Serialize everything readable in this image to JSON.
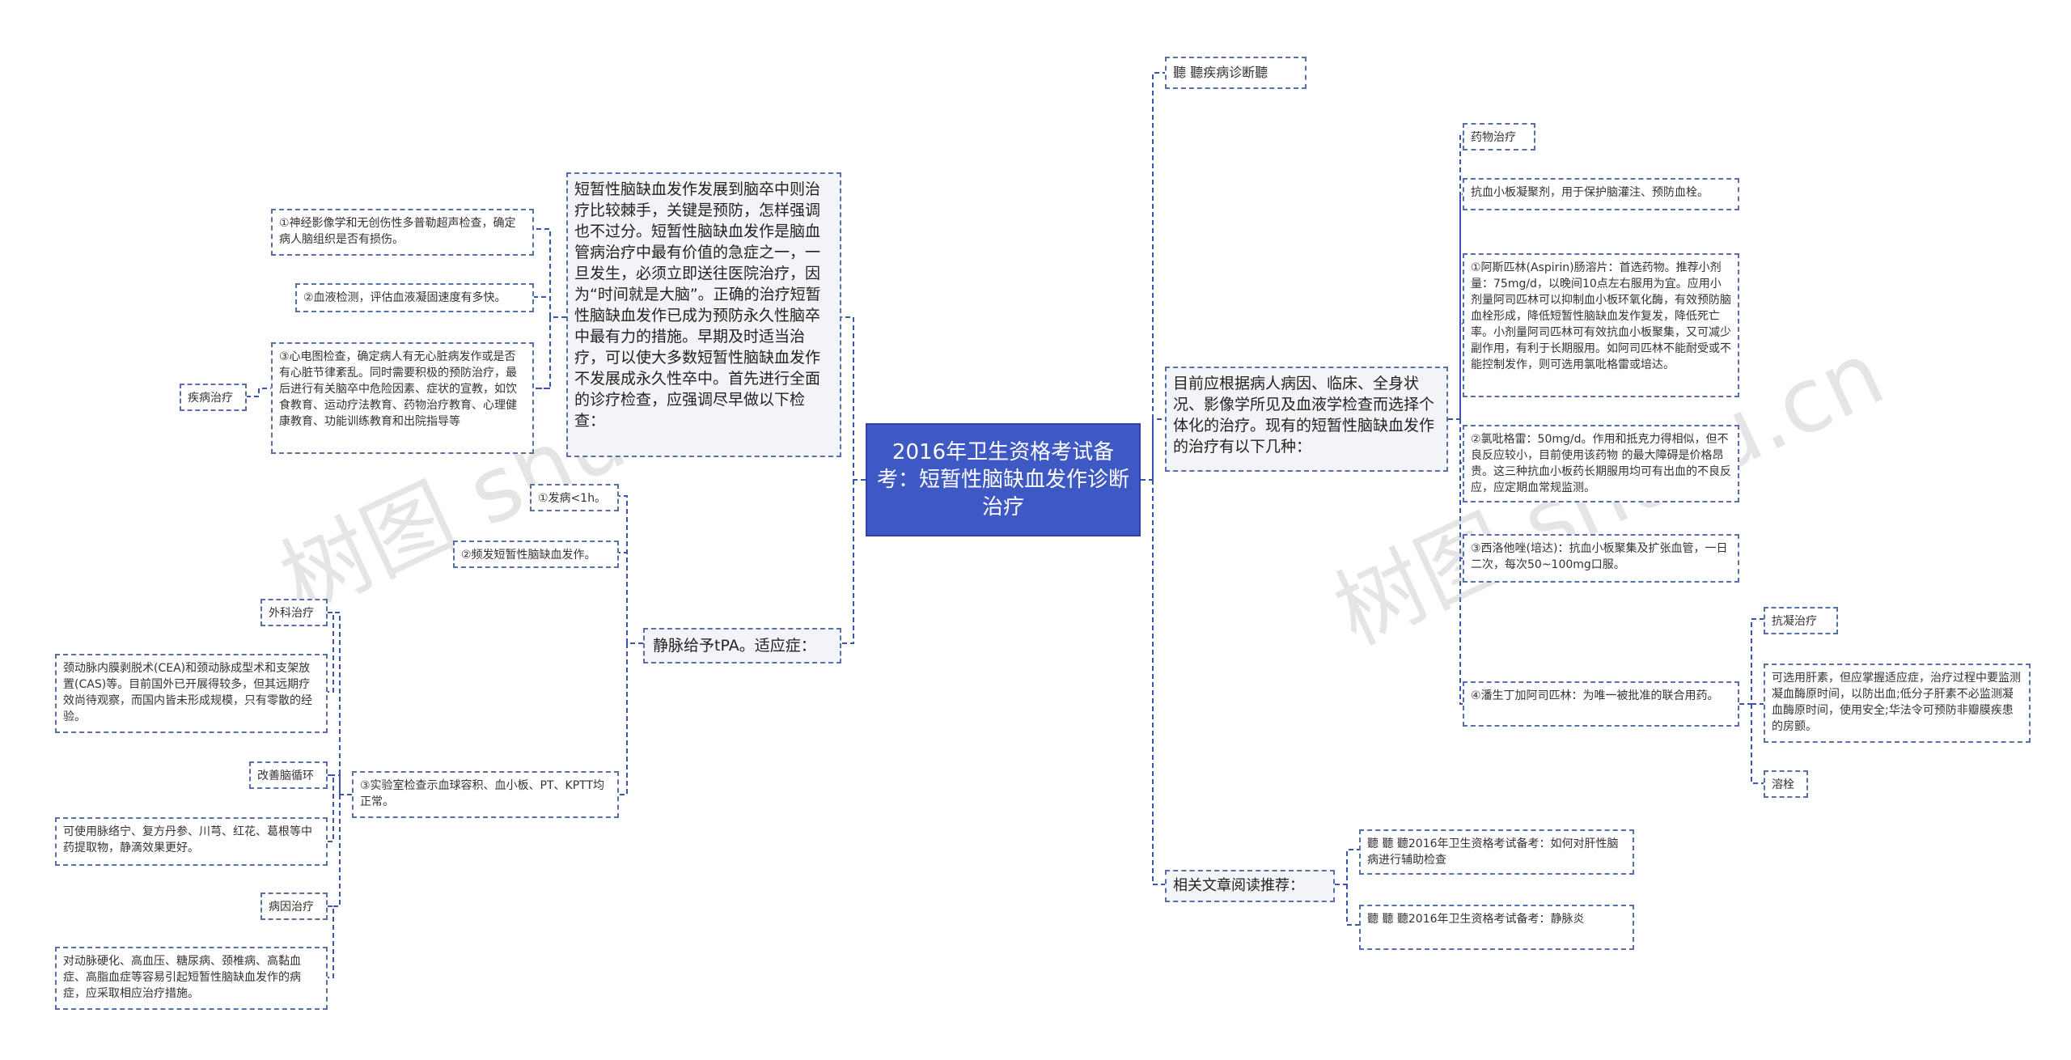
{
  "root": {
    "title": "2016年卫生资格考试备考：短暂性脑缺血发作诊断治疗"
  },
  "left": {
    "main_text": "短暂性脑缺血发作发展到脑卒中则治疗比较棘手，关键是预防，怎样强调也不过分。短暂性脑缺血发作是脑血管病治疗中最有价值的急症之一，一旦发生，必须立即送往医院治疗，因为“时间就是大脑”。正确的治疗短暂性脑缺血发作已成为预防永久性脑卒中最有力的措施。早期及时适当治疗，可以使大多数短暂性脑缺血发作不发展成永久性卒中。首先进行全面的诊疗检查，应强调尽早做以下检查：",
    "exam1": "①神经影像学和无创伤性多普勒超声检查，确定病人脑组织是否有损伤。",
    "exam2": "②血液检测，评估血液凝固速度有多快。",
    "exam3": "③心电图检查，确定病人有无心脏病发作或是否有心脏节律紊乱。同时需要积极的预防治疗，最后进行有关脑卒中危险因素、症状的宣教，如饮食教育、运动疗法教育、药物治疗教育、心理健康教育、功能训练教育和出院指导等",
    "disease_treatment": "疾病治疗",
    "tpa": "静脉给予tPA。适应症：",
    "tpa1": "①发病<1h。",
    "tpa2": "②频发短暂性脑缺血发作。",
    "tpa3": "③实验室检查示血球容积、血小板、PT、KPTT均正常。",
    "surgery": "外科治疗",
    "surgery_text": "颈动脉内膜剥脱术(CEA)和颈动脉成型术和支架放置(CAS)等。目前国外已开展得较多，但其远期疗效尚待观察，而国内皆未形成规模，只有零散的经验。",
    "circulation": "改善脑循环",
    "circulation_text": "可使用脉络宁、复方丹参、川芎、红花、葛根等中药提取物，静滴效果更好。",
    "cause": "病因治疗",
    "cause_text": "对动脉硬化、高血压、糖尿病、颈椎病、高黏血症、高脂血症等容易引起短暂性脑缺血发作的病症，应采取相应治疗措施。"
  },
  "right": {
    "diag": "聽 聽疾病诊断聽",
    "treat_text": "目前应根据病人病因、临床、全身状况、影像学所见及血液学检查而选择个体化的治疗。现有的短暂性脑缺血发作的治疗有以下几种：",
    "drug": "药物治疗",
    "antiplatelet": "抗血小板凝聚剂，用于保护脑灌注、预防血栓。",
    "aspirin": "①阿斯匹林(Aspirin)肠溶片：首选药物。推荐小剂量：75mg/d，以晚间10点左右服用为宜。应用小剂量阿司匹林可以抑制血小板环氧化酶，有效预防脑血栓形成，降低短暂性脑缺血发作复发，降低死亡率。小剂量阿司匹林可有效抗血小板聚集，又可减少副作用，有利于长期服用。如阿司匹林不能耐受或不能控制发作，则可选用氯吡格雷或培达。",
    "clopidogrel": "②氯吡格雷：50mg/d。作用和抵克力得相似，但不良反应较小，目前使用该药物 的最大障碍是价格昂贵。这三种抗血小板药长期服用均可有出血的不良反应，应定期血常规监测。",
    "cilostazol": "③西洛他唑(培达)：抗血小板聚集及扩张血管，一日二次，每次50~100mg口服。",
    "aggrenox": "④潘生丁加阿司匹林：为唯一被批准的联合用药。",
    "anticoag": "抗凝治疗",
    "anticoag_text": "可选用肝素，但应掌握适应症，治疗过程中要监测凝血酶原时间，以防出血;低分子肝素不必监测凝血酶原时间，使用安全;华法令可预防非瓣膜疾患的房颤。",
    "thrombolysis": "溶栓",
    "related": "相关文章阅读推荐：",
    "related1": "聽 聽 聽2016年卫生资格考试备考：如何对肝性脑病进行辅助检查",
    "related2": "聽 聽 聽2016年卫生资格考试备考：静脉炎"
  },
  "watermark": {
    "text_left": "树图 shu",
    "text_right": "树图 shutu.cn"
  }
}
